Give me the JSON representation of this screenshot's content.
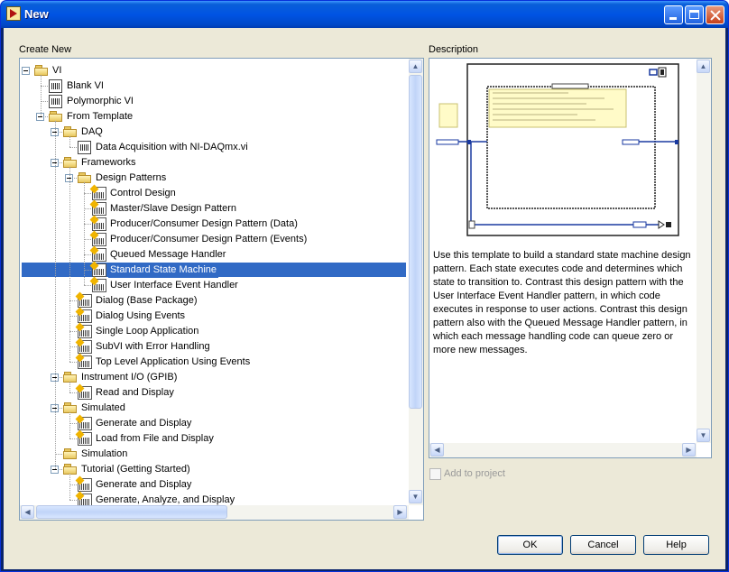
{
  "window": {
    "title": "New"
  },
  "left_panel": {
    "label": "Create New"
  },
  "tree": [
    {
      "label": "VI",
      "icon": "folder-icon",
      "depth": 0,
      "expander": true
    },
    {
      "label": "Blank VI",
      "icon": "vi-icon",
      "depth": 1
    },
    {
      "label": "Polymorphic VI",
      "icon": "vi-icon",
      "depth": 1
    },
    {
      "label": "From Template",
      "icon": "folder-icon",
      "depth": 1,
      "expander": true
    },
    {
      "label": "DAQ",
      "icon": "folder-icon",
      "depth": 2,
      "expander": true
    },
    {
      "label": "Data Acquisition with NI-DAQmx.vi",
      "icon": "vi-icon",
      "depth": 3
    },
    {
      "label": "Frameworks",
      "icon": "folder-icon",
      "depth": 2,
      "expander": true
    },
    {
      "label": "Design Patterns",
      "icon": "folder-icon",
      "depth": 3,
      "expander": true
    },
    {
      "label": "Control Design",
      "icon": "template-icon",
      "depth": 4
    },
    {
      "label": "Master/Slave Design Pattern",
      "icon": "template-icon",
      "depth": 4
    },
    {
      "label": "Producer/Consumer Design Pattern (Data)",
      "icon": "template-icon",
      "depth": 4
    },
    {
      "label": "Producer/Consumer Design Pattern (Events)",
      "icon": "template-icon",
      "depth": 4
    },
    {
      "label": "Queued Message Handler",
      "icon": "template-icon",
      "depth": 4
    },
    {
      "label": "Standard State Machine",
      "icon": "template-icon",
      "depth": 4,
      "selected": true
    },
    {
      "label": "User Interface Event Handler",
      "icon": "template-icon",
      "depth": 4
    },
    {
      "label": "Dialog (Base Package)",
      "icon": "template-icon",
      "depth": 3
    },
    {
      "label": "Dialog Using Events",
      "icon": "template-icon",
      "depth": 3
    },
    {
      "label": "Single Loop Application",
      "icon": "template-icon",
      "depth": 3
    },
    {
      "label": "SubVI with Error Handling",
      "icon": "template-icon",
      "depth": 3
    },
    {
      "label": "Top Level Application Using Events",
      "icon": "template-icon",
      "depth": 3
    },
    {
      "label": "Instrument I/O (GPIB)",
      "icon": "folder-icon",
      "depth": 2,
      "expander": true
    },
    {
      "label": "Read and Display",
      "icon": "template-icon",
      "depth": 3
    },
    {
      "label": "Simulated",
      "icon": "folder-icon",
      "depth": 2,
      "expander": true
    },
    {
      "label": "Generate and Display",
      "icon": "template-icon",
      "depth": 3
    },
    {
      "label": "Load from File and Display",
      "icon": "template-icon",
      "depth": 3
    },
    {
      "label": "Simulation",
      "icon": "folder-icon",
      "depth": 2
    },
    {
      "label": "Tutorial (Getting Started)",
      "icon": "folder-icon",
      "depth": 2,
      "expander": true
    },
    {
      "label": "Generate and Display",
      "icon": "template-icon",
      "depth": 3
    },
    {
      "label": "Generate, Analyze, and Display",
      "icon": "template-icon",
      "depth": 3
    }
  ],
  "description": {
    "label": "Description",
    "text": "Use this template to build a standard state machine design pattern. Each state executes code and determines which state to transition to. Contrast this design pattern with the User Interface Event Handler pattern, in which code executes in response to user actions. Contrast this design pattern also with the Queued Message Handler pattern, in which each message handling code can queue zero or more new messages."
  },
  "add_to_project": {
    "label": "Add to project",
    "checked": false,
    "enabled": false
  },
  "buttons": {
    "ok": "OK",
    "cancel": "Cancel",
    "help": "Help"
  }
}
